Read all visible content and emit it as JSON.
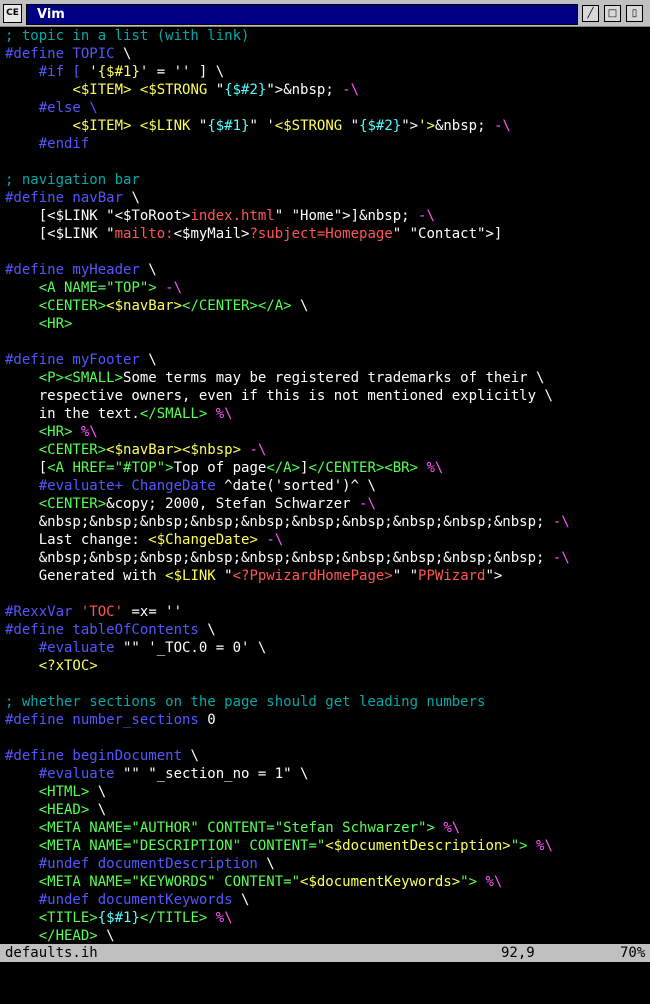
{
  "window": {
    "title": "Vim",
    "icon_label": "CE",
    "buttons": [
      "minimize-button",
      "maximize-button",
      "close-button"
    ]
  },
  "editor": {
    "lines": [
      [
        [
          "c",
          "; topic in a list (with link)"
        ]
      ],
      [
        [
          "d",
          "#define TOPIC"
        ],
        [
          "w",
          " \\"
        ]
      ],
      [
        [
          "w",
          "    "
        ],
        [
          "d",
          "#if ["
        ],
        [
          "w",
          " '"
        ],
        [
          "y",
          "{$#1}"
        ],
        [
          "w",
          "' = '' ] \\"
        ]
      ],
      [
        [
          "w",
          "        "
        ],
        [
          "y",
          "<$ITEM>"
        ],
        [
          "w",
          " "
        ],
        [
          "y",
          "<$STRONG"
        ],
        [
          "w",
          " \""
        ],
        [
          "b",
          "{$#2}"
        ],
        [
          "w",
          "\">&nbsp; "
        ],
        [
          "m",
          "-\\"
        ]
      ],
      [
        [
          "w",
          "    "
        ],
        [
          "d",
          "#else \\"
        ]
      ],
      [
        [
          "w",
          "        "
        ],
        [
          "y",
          "<$ITEM>"
        ],
        [
          "w",
          " "
        ],
        [
          "y",
          "<$LINK"
        ],
        [
          "w",
          " \""
        ],
        [
          "b",
          "{$#1}"
        ],
        [
          "w",
          "\" '"
        ],
        [
          "y",
          "<$STRONG"
        ],
        [
          "w",
          " \""
        ],
        [
          "b",
          "{$#2}"
        ],
        [
          "w",
          "\">"
        ],
        [
          "y",
          "'>"
        ],
        [
          "w",
          "&nbsp; "
        ],
        [
          "m",
          "-\\"
        ]
      ],
      [
        [
          "w",
          "    "
        ],
        [
          "d",
          "#endif"
        ]
      ],
      [],
      [
        [
          "c",
          "; navigation bar"
        ]
      ],
      [
        [
          "d",
          "#define navBar"
        ],
        [
          "w",
          " \\"
        ]
      ],
      [
        [
          "w",
          "    [<$LINK \"<$ToRoot>"
        ],
        [
          "r",
          "index.html"
        ],
        [
          "w",
          "\" \"Home\">]&nbsp; "
        ],
        [
          "m",
          "-\\"
        ]
      ],
      [
        [
          "w",
          "    [<$LINK \""
        ],
        [
          "r",
          "mailto:"
        ],
        [
          "w",
          "<$myMail>"
        ],
        [
          "r",
          "?subject=Homepage"
        ],
        [
          "w",
          "\" \"Contact\">]"
        ]
      ],
      [],
      [
        [
          "d",
          "#define myHeader"
        ],
        [
          "w",
          " \\"
        ]
      ],
      [
        [
          "w",
          "    "
        ],
        [
          "g",
          "<A NAME=\"TOP\">"
        ],
        [
          "w",
          " "
        ],
        [
          "m",
          "-\\"
        ]
      ],
      [
        [
          "w",
          "    "
        ],
        [
          "g",
          "<CENTER>"
        ],
        [
          "y",
          "<$navBar>"
        ],
        [
          "g",
          "</CENTER></A>"
        ],
        [
          "w",
          " \\"
        ]
      ],
      [
        [
          "w",
          "    "
        ],
        [
          "g",
          "<HR>"
        ]
      ],
      [],
      [
        [
          "d",
          "#define myFooter"
        ],
        [
          "w",
          " \\"
        ]
      ],
      [
        [
          "w",
          "    "
        ],
        [
          "g",
          "<P><SMALL>"
        ],
        [
          "w",
          "Some terms may be registered trademarks of their \\"
        ]
      ],
      [
        [
          "w",
          "    respective owners, even if this is not mentioned explicitly \\"
        ]
      ],
      [
        [
          "w",
          "    in the text."
        ],
        [
          "g",
          "</SMALL>"
        ],
        [
          "w",
          " "
        ],
        [
          "m",
          "%\\"
        ]
      ],
      [
        [
          "w",
          "    "
        ],
        [
          "g",
          "<HR>"
        ],
        [
          "w",
          " "
        ],
        [
          "m",
          "%\\"
        ]
      ],
      [
        [
          "w",
          "    "
        ],
        [
          "g",
          "<CENTER>"
        ],
        [
          "y",
          "<$navBar><$nbsp>"
        ],
        [
          "w",
          " "
        ],
        [
          "m",
          "-\\"
        ]
      ],
      [
        [
          "w",
          "    ["
        ],
        [
          "g",
          "<A HREF=\"#TOP\">"
        ],
        [
          "w",
          "Top of page"
        ],
        [
          "g",
          "</A>"
        ],
        [
          "w",
          "]"
        ],
        [
          "g",
          "</CENTER><BR>"
        ],
        [
          "w",
          " "
        ],
        [
          "m",
          "%\\"
        ]
      ],
      [
        [
          "w",
          "    "
        ],
        [
          "d",
          "#evaluate+ ChangeDate"
        ],
        [
          "w",
          " ^date('sorted')^ \\"
        ]
      ],
      [
        [
          "w",
          "    "
        ],
        [
          "g",
          "<CENTER>"
        ],
        [
          "w",
          "&copy; 2000, Stefan Schwarzer "
        ],
        [
          "m",
          "-\\"
        ]
      ],
      [
        [
          "w",
          "    &nbsp;&nbsp;&nbsp;&nbsp;&nbsp;&nbsp;&nbsp;&nbsp;&nbsp;&nbsp; "
        ],
        [
          "m",
          "-\\"
        ]
      ],
      [
        [
          "w",
          "    Last change: "
        ],
        [
          "y",
          "<$ChangeDate>"
        ],
        [
          "w",
          " "
        ],
        [
          "m",
          "-\\"
        ]
      ],
      [
        [
          "w",
          "    &nbsp;&nbsp;&nbsp;&nbsp;&nbsp;&nbsp;&nbsp;&nbsp;&nbsp;&nbsp; "
        ],
        [
          "m",
          "-\\"
        ]
      ],
      [
        [
          "w",
          "    Generated with "
        ],
        [
          "y",
          "<$LINK"
        ],
        [
          "w",
          " \""
        ],
        [
          "r",
          "<?PpwizardHomePage>"
        ],
        [
          "w",
          "\" \""
        ],
        [
          "r",
          "PPWizard"
        ],
        [
          "w",
          "\">"
        ]
      ],
      [],
      [
        [
          "d",
          "#RexxVar"
        ],
        [
          "w",
          " "
        ],
        [
          "r",
          "'TOC'"
        ],
        [
          "w",
          " =x= ''"
        ]
      ],
      [
        [
          "d",
          "#define tableOfContents"
        ],
        [
          "w",
          " \\"
        ]
      ],
      [
        [
          "w",
          "    "
        ],
        [
          "d",
          "#evaluate"
        ],
        [
          "w",
          " \"\" '_TOC.0 = 0' \\"
        ]
      ],
      [
        [
          "w",
          "    "
        ],
        [
          "y",
          "<?xTOC>"
        ]
      ],
      [],
      [
        [
          "c",
          "; whether sections on the page should get leading numbers"
        ]
      ],
      [
        [
          "d",
          "#define number_sections"
        ],
        [
          "w",
          " 0"
        ]
      ],
      [],
      [
        [
          "d",
          "#define beginDocument"
        ],
        [
          "w",
          " \\"
        ]
      ],
      [
        [
          "w",
          "    "
        ],
        [
          "d",
          "#evaluate"
        ],
        [
          "w",
          " \"\" \"_section_no = 1\" \\"
        ]
      ],
      [
        [
          "w",
          "    "
        ],
        [
          "g",
          "<HTML>"
        ],
        [
          "w",
          " \\"
        ]
      ],
      [
        [
          "w",
          "    "
        ],
        [
          "g",
          "<HEAD>"
        ],
        [
          "w",
          " \\"
        ]
      ],
      [
        [
          "w",
          "    "
        ],
        [
          "g",
          "<META NAME=\"AUTHOR\" CONTENT=\"Stefan Schwarzer\">"
        ],
        [
          "w",
          " "
        ],
        [
          "m",
          "%\\"
        ]
      ],
      [
        [
          "w",
          "    "
        ],
        [
          "g",
          "<META NAME=\"DESCRIPTION\" CONTENT=\""
        ],
        [
          "y",
          "<$documentDescription>"
        ],
        [
          "g",
          "\">"
        ],
        [
          "w",
          " "
        ],
        [
          "m",
          "%\\"
        ]
      ],
      [
        [
          "w",
          "    "
        ],
        [
          "d",
          "#undef documentDescription"
        ],
        [
          "w",
          " \\"
        ]
      ],
      [
        [
          "w",
          "    "
        ],
        [
          "g",
          "<META NAME=\"KEYWORDS\" CONTENT=\""
        ],
        [
          "y",
          "<$documentKeywords>"
        ],
        [
          "g",
          "\">"
        ],
        [
          "w",
          " "
        ],
        [
          "m",
          "%\\"
        ]
      ],
      [
        [
          "w",
          "    "
        ],
        [
          "d",
          "#undef documentKeywords"
        ],
        [
          "w",
          " \\"
        ]
      ],
      [
        [
          "w",
          "    "
        ],
        [
          "g",
          "<TITLE>"
        ],
        [
          "b",
          "{$#1}"
        ],
        [
          "g",
          "</TITLE>"
        ],
        [
          "w",
          " "
        ],
        [
          "m",
          "%\\"
        ]
      ],
      [
        [
          "w",
          "    "
        ],
        [
          "g",
          "</HEAD>"
        ],
        [
          "w",
          " \\"
        ]
      ]
    ]
  },
  "status": {
    "filename": "defaults.ih",
    "position": "92,9",
    "percent": "70%"
  },
  "colors": {
    "comment": "#00aaaa",
    "preproc": "#5555ff",
    "macro": "#ffff55",
    "tag": "#55ff55",
    "string": "#ff5555",
    "special": "#ff55ff",
    "param": "#55ffff",
    "text": "#ffffff"
  }
}
